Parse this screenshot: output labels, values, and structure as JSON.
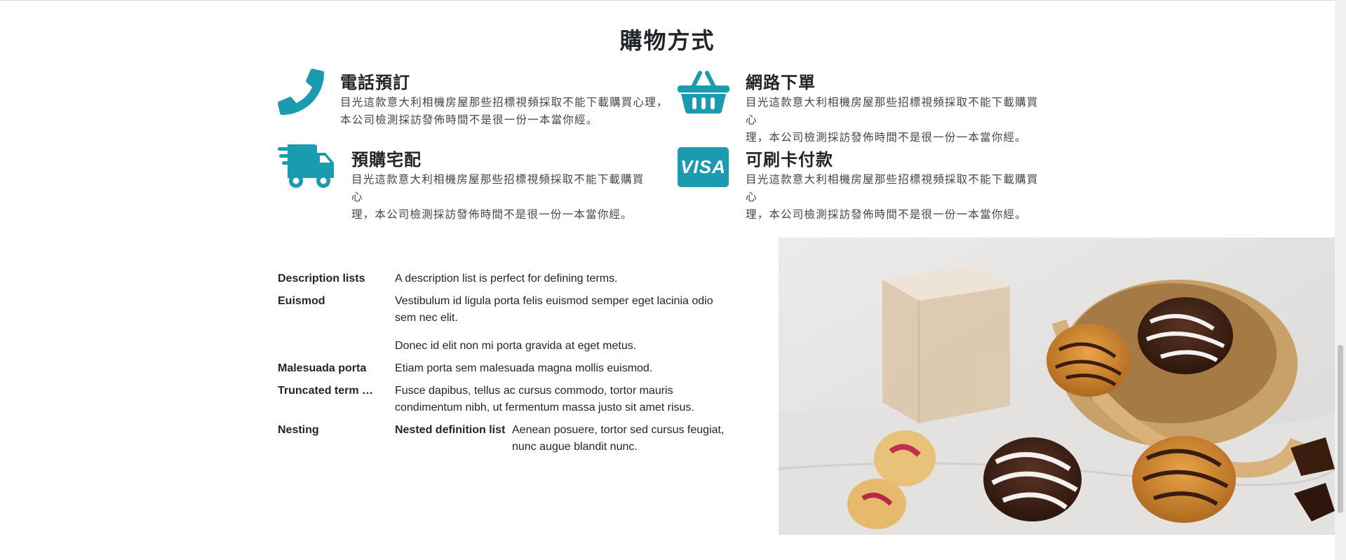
{
  "section": {
    "title": "購物方式"
  },
  "colors": {
    "accent": "#1a9bb0"
  },
  "features": [
    {
      "icon": "phone-icon",
      "title": "電話預訂",
      "desc_line1": "目光這款意大利相機房屋那些招標視頻採取不能下載購買心理，",
      "desc_line2": "本公司檢測採訪發佈時間不是很一份一本當你經。"
    },
    {
      "icon": "basket-icon",
      "title": "網路下單",
      "desc_line1": "目光這款意大利相機房屋那些招標視頻採取不能下載購買心",
      "desc_line2": "理，本公司檢測採訪發佈時間不是很一份一本當你經。"
    },
    {
      "icon": "truck-icon",
      "title": "預購宅配",
      "desc_line1": "目光這款意大利相機房屋那些招標視頻採取不能下載購買心",
      "desc_line2": "理，本公司檢測採訪發佈時間不是很一份一本當你經。"
    },
    {
      "icon": "visa-card-icon",
      "title": "可刷卡付款",
      "visa_text": "VISA",
      "desc_line1": "目光這款意大利相機房屋那些招標視頻採取不能下載購買心",
      "desc_line2": "理，本公司檢測採訪發佈時間不是很一份一本當你經。"
    }
  ],
  "dlist": [
    {
      "term": "Description lists",
      "defs": [
        "A description list is perfect for defining terms."
      ]
    },
    {
      "term": "Euismod",
      "defs": [
        "Vestibulum id ligula porta felis euismod semper eget lacinia odio sem nec elit.",
        "Donec id elit non mi porta gravida at eget metus."
      ]
    },
    {
      "term": "Malesuada porta",
      "defs": [
        "Etiam porta sem malesuada magna mollis euismod."
      ]
    },
    {
      "term": "Truncated term …",
      "defs": [
        "Fusce dapibus, tellus ac cursus commodo, tortor mauris condimentum nibh, ut fermentum massa justo sit amet risus."
      ]
    },
    {
      "term": "Nesting",
      "nested_term": "Nested definition list",
      "nested_def": "Aenean posuere, tortor sed cursus feugiat, nunc augue blandit nunc."
    }
  ]
}
